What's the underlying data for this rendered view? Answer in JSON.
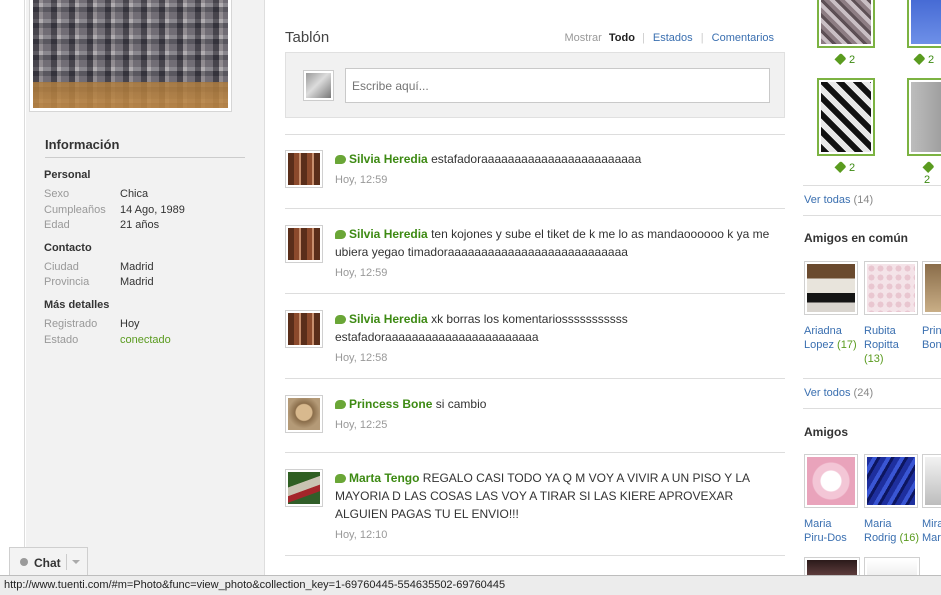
{
  "profile": {
    "info_title": "Información",
    "personal": {
      "heading": "Personal",
      "rows": [
        {
          "key": "Sexo",
          "value": "Chica"
        },
        {
          "key": "Cumpleaños",
          "value": "14 Ago, 1989"
        },
        {
          "key": "Edad",
          "value": "21 años"
        }
      ]
    },
    "contacto": {
      "heading": "Contacto",
      "rows": [
        {
          "key": "Ciudad",
          "value": "Madrid"
        },
        {
          "key": "Provincia",
          "value": "Madrid"
        }
      ]
    },
    "mas_detalles": {
      "heading": "Más detalles",
      "rows": [
        {
          "key": "Registrado",
          "value": "Hoy"
        },
        {
          "key": "Estado",
          "value": "conectado"
        }
      ]
    }
  },
  "wall": {
    "title": "Tablón",
    "filter": {
      "label": "Mostrar",
      "current": "Todo",
      "options": [
        "Estados",
        "Comentarios"
      ]
    },
    "compose_placeholder": "Escribe aquí...",
    "posts": [
      {
        "author": "Silvia Heredia",
        "text": "estafadoraaaaaaaaaaaaaaaaaaaaaaaa",
        "time": "Hoy, 12:59"
      },
      {
        "author": "Silvia Heredia",
        "text": "ten kojones y sube el tiket de k me lo as mandaoooooo k ya me ubiera yegao timadoraaaaaaaaaaaaaaaaaaaaaaaaaaa",
        "time": "Hoy, 12:59"
      },
      {
        "author": "Silvia Heredia",
        "text": "xk borras los komentariosssssssssss estafadoraaaaaaaaaaaaaaaaaaaaaaa",
        "time": "Hoy, 12:58"
      },
      {
        "author": "Princess Bone",
        "text": "si cambio",
        "time": "Hoy, 12:25"
      },
      {
        "author": "Marta Tengo",
        "text": "REGALO CASI TODO YA Q M VOY A VIVIR A UN PISO Y LA MAYORIA D LAS COSAS LAS VOY A TIRAR SI LAS KIERE APROVEXAR ALGUIEN PAGAS TU EL ENVIO!!!",
        "time": "Hoy, 12:10"
      }
    ]
  },
  "sidebar_right": {
    "photo_tags": [
      "2",
      "2",
      "2",
      "2"
    ],
    "ver_todas": {
      "label": "Ver todas",
      "count": "(14)"
    },
    "amigos_comun": {
      "heading": "Amigos en común",
      "friends": [
        {
          "first": "Ariadna",
          "last": "Lopez",
          "count": "(17)"
        },
        {
          "first": "Rubita",
          "last": "Ropitta",
          "count": "(13)"
        },
        {
          "first": "Prin",
          "last": "Bon",
          "count": ""
        }
      ],
      "ver_todos": {
        "label": "Ver todos",
        "count": "(24)"
      }
    },
    "amigos": {
      "heading": "Amigos",
      "friends": [
        {
          "first": "Maria",
          "last": "Piru-Dos",
          "count": ""
        },
        {
          "first": "Maria",
          "last": "Rodrig",
          "count": "(16)"
        },
        {
          "first": "Mira",
          "last": "Mar",
          "count": ""
        }
      ]
    }
  },
  "chat": {
    "label": "Chat"
  },
  "status_bar": {
    "url": "http://www.tuenti.com/#m=Photo&func=view_photo&collection_key=1-69760445-554635502-69760445"
  }
}
